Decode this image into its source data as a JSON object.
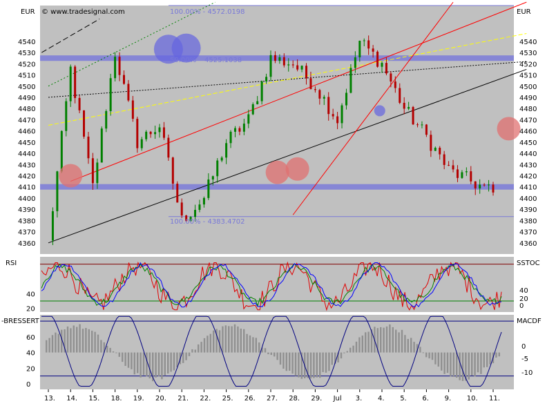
{
  "header": {
    "copyright": "© www.tradesignal.com",
    "currency_left": "EUR",
    "currency_right": "EUR"
  },
  "colors": {
    "panel_bg": "#c0c0c0",
    "up_candle": "#008000",
    "down_candle": "#b40000",
    "support_band": "#7b7bd8",
    "circle_red": "#e07070",
    "circle_blue": "#6464e0",
    "fib_line": "#7b7bd8",
    "trend_red": "#ff0000",
    "trend_black": "#000000",
    "trend_yellow": "#ffff00",
    "rsi_red": "#e00000",
    "rsi_green": "#008000",
    "rsi_blue": "#0000ff",
    "macd_line": "#000080",
    "macd_hist": "#909090"
  },
  "chart_data": [
    {
      "type": "candlestick",
      "ylim": [
        4350,
        4572
      ],
      "yticks": [
        4360,
        4370,
        4380,
        4390,
        4400,
        4410,
        4420,
        4430,
        4440,
        4450,
        4460,
        4470,
        4480,
        4490,
        4500,
        4510,
        4520,
        4530,
        4540
      ],
      "x_labels": [
        "13.",
        "14.",
        "15.",
        "18.",
        "19.",
        "20.",
        "21.",
        "22.",
        "25.",
        "26.",
        "27.",
        "28.",
        "29.",
        "Jul",
        "3.",
        "4.",
        "5.",
        "6.",
        "9.",
        "10.",
        "11."
      ],
      "annotations": {
        "fib_top_label": "100.00% - 4572.0198",
        "fib_mid_label": "4525.1038",
        "fib_mid_prefix": "50.00%",
        "fib_bottom_label": "100.00% - 4383.4702"
      },
      "support_levels": [
        4410,
        4525
      ],
      "fib_levels": [
        4572.0198,
        4383.4702
      ],
      "anchors": [
        4360,
        4515,
        4410,
        4530,
        4450,
        4465,
        4380,
        4400,
        4450,
        4470,
        4525,
        4520,
        4500,
        4470,
        4540,
        4520,
        4480,
        4455,
        4425,
        4415,
        4405
      ],
      "red_circles": [
        {
          "x": 1,
          "y": 4420
        },
        {
          "x": 10.3,
          "y": 4423
        },
        {
          "x": 11.2,
          "y": 4426
        },
        {
          "x": 20.7,
          "y": 4462
        }
      ],
      "blue_circles": [
        {
          "x": 5.4,
          "y": 4533
        },
        {
          "x": 6.2,
          "y": 4534
        },
        {
          "x": 14.9,
          "y": 4478
        }
      ]
    },
    {
      "type": "line",
      "title": "RSI",
      "title_right": "SSTOC",
      "ylim": [
        15,
        90
      ],
      "yticks_left": [
        20,
        40
      ],
      "yticks_right": [
        0,
        20,
        40
      ],
      "upper_level": 80,
      "lower_level": 30
    },
    {
      "type": "bar",
      "title": "-BRESSERT",
      "title_right": "MACDF",
      "ylim": [
        -7,
        88
      ],
      "yticks_left": [
        0,
        20,
        40,
        60
      ],
      "yticks_right": [
        0,
        -5,
        -10
      ],
      "upper_level": 80,
      "lower_level": 10
    }
  ]
}
